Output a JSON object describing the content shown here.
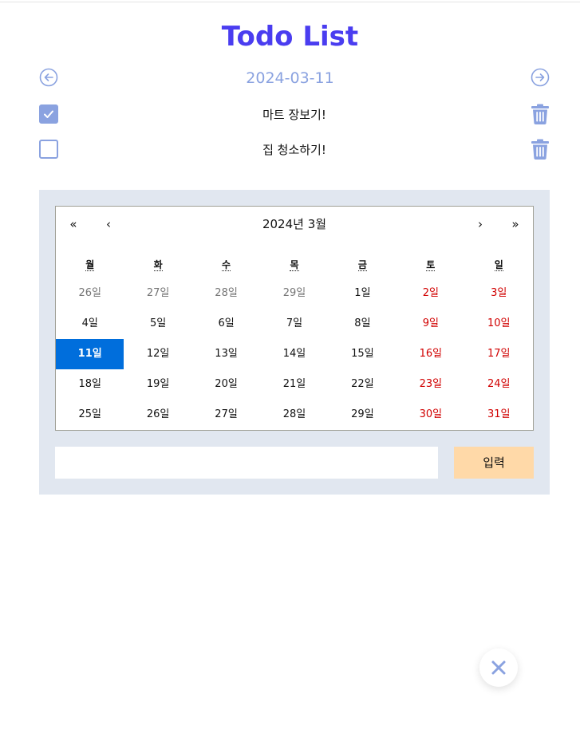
{
  "app": {
    "title": "Todo List",
    "current_date": "2024-03-11",
    "accent_color": "#4a3df0",
    "icon_color": "#8aa2e0"
  },
  "todos": [
    {
      "text": "마트 장보기!",
      "done": true
    },
    {
      "text": "집 청소하기!",
      "done": false
    }
  ],
  "calendar": {
    "label": "2024년 3월",
    "nav": {
      "prev_year": "«",
      "prev_month": "‹",
      "next_month": "›",
      "next_year": "»"
    },
    "weekdays": [
      "월",
      "화",
      "수",
      "목",
      "금",
      "토",
      "일"
    ],
    "days": [
      {
        "label": "26일",
        "type": "other"
      },
      {
        "label": "27일",
        "type": "other"
      },
      {
        "label": "28일",
        "type": "other"
      },
      {
        "label": "29일",
        "type": "other"
      },
      {
        "label": "1일",
        "type": "normal"
      },
      {
        "label": "2일",
        "type": "weekend"
      },
      {
        "label": "3일",
        "type": "weekend"
      },
      {
        "label": "4일",
        "type": "normal"
      },
      {
        "label": "5일",
        "type": "normal"
      },
      {
        "label": "6일",
        "type": "normal"
      },
      {
        "label": "7일",
        "type": "normal"
      },
      {
        "label": "8일",
        "type": "normal"
      },
      {
        "label": "9일",
        "type": "weekend"
      },
      {
        "label": "10일",
        "type": "weekend"
      },
      {
        "label": "11일",
        "type": "active"
      },
      {
        "label": "12일",
        "type": "normal"
      },
      {
        "label": "13일",
        "type": "normal"
      },
      {
        "label": "14일",
        "type": "normal"
      },
      {
        "label": "15일",
        "type": "normal"
      },
      {
        "label": "16일",
        "type": "weekend"
      },
      {
        "label": "17일",
        "type": "weekend"
      },
      {
        "label": "18일",
        "type": "normal"
      },
      {
        "label": "19일",
        "type": "normal"
      },
      {
        "label": "20일",
        "type": "normal"
      },
      {
        "label": "21일",
        "type": "normal"
      },
      {
        "label": "22일",
        "type": "normal"
      },
      {
        "label": "23일",
        "type": "weekend"
      },
      {
        "label": "24일",
        "type": "weekend"
      },
      {
        "label": "25일",
        "type": "normal"
      },
      {
        "label": "26일",
        "type": "normal"
      },
      {
        "label": "27일",
        "type": "normal"
      },
      {
        "label": "28일",
        "type": "normal"
      },
      {
        "label": "29일",
        "type": "normal"
      },
      {
        "label": "30일",
        "type": "weekend"
      },
      {
        "label": "31일",
        "type": "weekend"
      }
    ]
  },
  "entry": {
    "input_value": "",
    "submit_label": "입력"
  },
  "icons": {
    "prev": "arrow-left-circle-icon",
    "next": "arrow-right-circle-icon",
    "check": "check-icon",
    "trash": "trash-icon",
    "close": "close-icon"
  }
}
